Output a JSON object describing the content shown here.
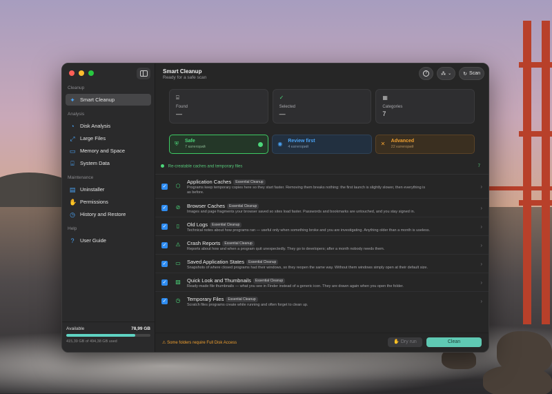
{
  "sidebar": {
    "sections": [
      {
        "title": "Cleanup",
        "items": [
          {
            "label": "Smart Cleanup",
            "icon": "sparkle-icon",
            "active": true
          }
        ]
      },
      {
        "title": "Analysis",
        "items": [
          {
            "label": "Disk Analysis",
            "icon": "pie-chart-icon"
          },
          {
            "label": "Large Files",
            "icon": "large-files-icon"
          },
          {
            "label": "Memory and Space",
            "icon": "memory-icon"
          },
          {
            "label": "System Data",
            "icon": "drive-icon"
          }
        ]
      },
      {
        "title": "Maintenance",
        "items": [
          {
            "label": "Uninstaller",
            "icon": "uninstaller-icon"
          },
          {
            "label": "Permissions",
            "icon": "hand-icon"
          },
          {
            "label": "History and Restore",
            "icon": "clock-icon"
          }
        ]
      },
      {
        "title": "Help",
        "items": [
          {
            "label": "User Guide",
            "icon": "question-icon"
          }
        ]
      }
    ],
    "storage": {
      "label": "Available",
      "value": "78,99 GB",
      "used_fraction": 0.82,
      "subtitle": "415,39 GB of 494,38 GB used"
    }
  },
  "header": {
    "title": "Smart Cleanup",
    "subtitle": "Ready for a safe scan",
    "scan_label": "Scan"
  },
  "stats": [
    {
      "label": "Found",
      "value": "—",
      "icon": "drive-icon"
    },
    {
      "label": "Selected",
      "value": "—",
      "icon": "check-circle-icon"
    },
    {
      "label": "Categories",
      "value": "7",
      "icon": "grid-icon"
    }
  ],
  "tiers": [
    {
      "title": "Safe",
      "subtitle": "7 категорий"
    },
    {
      "title": "Review first",
      "subtitle": "4 категорий"
    },
    {
      "title": "Advanced",
      "subtitle": "22 категорий"
    }
  ],
  "list": {
    "heading": "Re-creatable caches and temporary files",
    "count": "7",
    "items": [
      {
        "title": "Application Caches",
        "badge": "Essential Cleanup",
        "desc": "Programs keep temporary copies here so they start faster. Removing them breaks nothing: the first launch is slightly slower, then everything is",
        "desc2": "as before."
      },
      {
        "title": "Browser Caches",
        "badge": "Essential Cleanup",
        "desc": "Images and page fragments your browser saved so sites load faster. Passwords and bookmarks are untouched, and you stay signed in."
      },
      {
        "title": "Old Logs",
        "badge": "Essential Cleanup",
        "desc": "Technical notes about how programs ran — useful only when something broke and you are investigating. Anything older than a month is useless."
      },
      {
        "title": "Crash Reports",
        "badge": "Essential Cleanup",
        "desc": "Reports about how and when a program quit unexpectedly. They go to developers; after a month nobody needs them."
      },
      {
        "title": "Saved Application States",
        "badge": "Essential Cleanup",
        "desc": "Snapshots of where closed programs had their windows, so they reopen the same way. Without them windows simply open at their default size."
      },
      {
        "title": "Quick Look and Thumbnails",
        "badge": "Essential Cleanup",
        "desc": "Ready-made file thumbnails — what you see in Finder instead of a generic icon. They are drawn again when you open the folder."
      },
      {
        "title": "Temporary Files",
        "badge": "Essential Cleanup",
        "desc": "Scratch files programs create while running and often forget to clean up."
      }
    ]
  },
  "footer": {
    "warning": "Some folders require Full Disk Access",
    "dry_run_label": "Dry run",
    "clean_label": "Clean"
  }
}
